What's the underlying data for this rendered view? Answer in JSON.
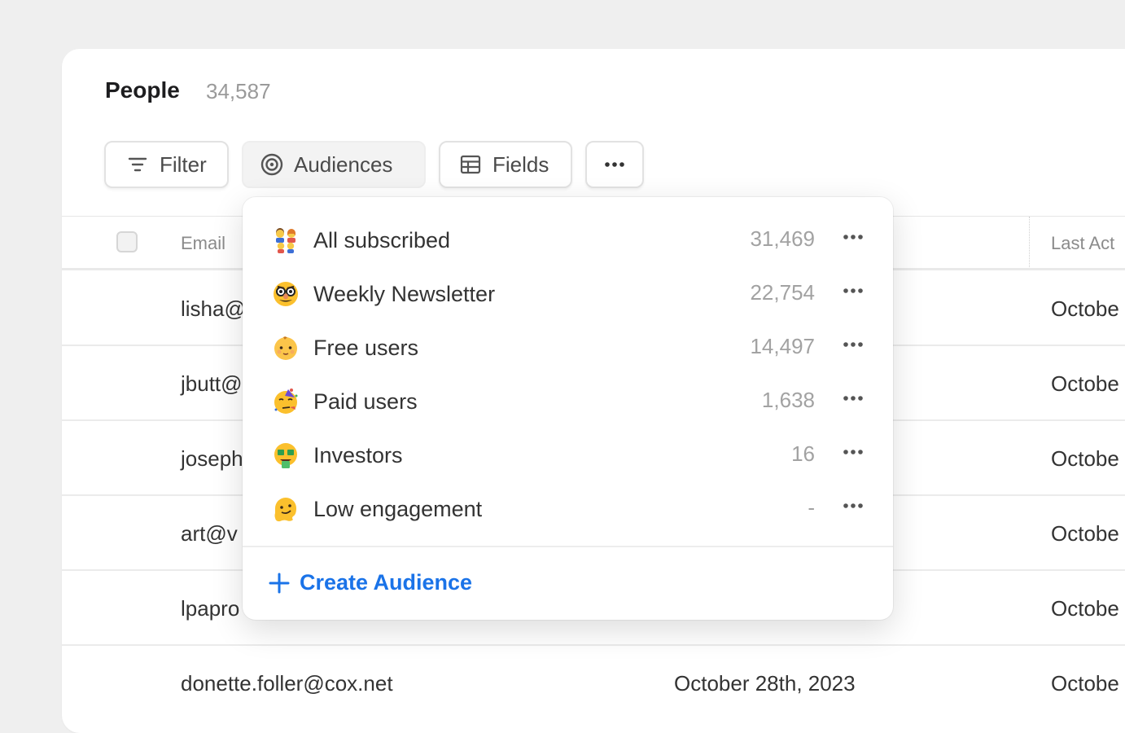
{
  "header": {
    "title": "People",
    "count": "34,587"
  },
  "toolbar": {
    "filter_label": "Filter",
    "audiences_label": "Audiences",
    "fields_label": "Fields"
  },
  "table": {
    "columns": {
      "email": "Email",
      "last_activity": "Last Act"
    },
    "rows": [
      {
        "email": "lisha@",
        "date": "",
        "last": "Octobe"
      },
      {
        "email": "jbutt@",
        "date": "",
        "last": "Octobe"
      },
      {
        "email": "joseph",
        "date": "",
        "last": "Octobe"
      },
      {
        "email": "art@v",
        "date": "",
        "last": "Octobe"
      },
      {
        "email": "lpapro",
        "date": "",
        "last": "Octobe"
      },
      {
        "email": "donette.foller@cox.net",
        "date": "October 28th, 2023",
        "last": "Octobe"
      }
    ]
  },
  "audiences": {
    "items": [
      {
        "emoji": "family-emoji",
        "label": "All subscribed",
        "count": "31,469"
      },
      {
        "emoji": "disguised-face-emoji",
        "label": "Weekly Newsletter",
        "count": "22,754"
      },
      {
        "emoji": "baby-emoji",
        "label": "Free users",
        "count": "14,497"
      },
      {
        "emoji": "partying-face-emoji",
        "label": "Paid users",
        "count": "1,638"
      },
      {
        "emoji": "money-mouth-face-emoji",
        "label": "Investors",
        "count": "16"
      },
      {
        "emoji": "melting-face-emoji",
        "label": "Low engagement",
        "count": "-"
      }
    ],
    "create_label": "Create Audience"
  },
  "colors": {
    "accent": "#1a73e8",
    "background": "#efefef",
    "muted_text": "#9a9a9a"
  }
}
